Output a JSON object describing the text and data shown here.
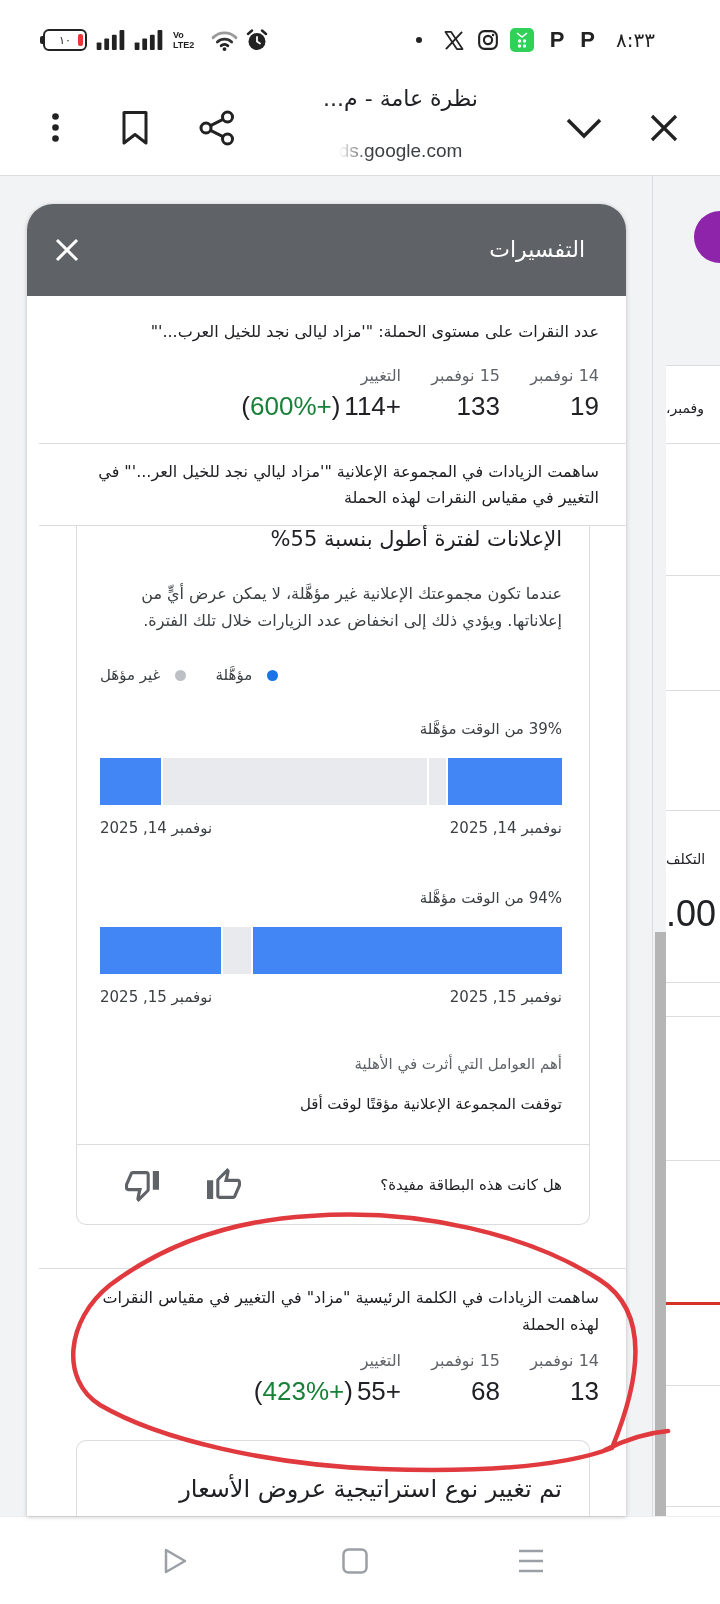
{
  "status_bar": {
    "time": "٨:٣٣",
    "notification_icons": [
      {
        "kind": "letter",
        "text": "P"
      },
      {
        "kind": "letter",
        "text": "P"
      },
      {
        "kind": "store"
      },
      {
        "kind": "instagram"
      },
      {
        "kind": "x"
      },
      {
        "kind": "dot"
      }
    ],
    "network_label": "Vo LTE2",
    "battery_label": "١٠"
  },
  "browser_bar": {
    "title": "نظرة عامة - م...",
    "url": "ds.google.com"
  },
  "background_page": {
    "date_fragment": "وفمبر،",
    "cost_label": "التكلف",
    "cost_value": ".00"
  },
  "panel": {
    "title": "التفسيرات",
    "summary": {
      "text": "عدد النقرات على مستوى الحملة: \"'مزاد ليالى نجد للخيل العرب...'\"",
      "columns": [
        {
          "kind": "count",
          "label": "14 نوفمبر",
          "value": "19"
        },
        {
          "kind": "count",
          "label": "15 نوفمبر",
          "value": "133"
        },
        {
          "kind": "change",
          "label": "التغيير",
          "value": "+114",
          "change_percent": "(+600%)"
        }
      ]
    },
    "contribution_note": "ساهمت الزيادات في المجموعة الإعلانية \"'مزاد ليالي نجد للخيل العر...'\" في التغيير في مقياس النقرات لهذه الحملة",
    "insight_card": {
      "heading": "الإعلانات لفترة أطول بنسبة 55%",
      "description": "عندما تكون مجموعتك الإعلانية غير مؤهَّلة، لا يمكن عرض أيٍّ من إعلاناتها. ويؤدي ذلك إلى انخفاض عدد الزيارات خلال تلك الفترة.",
      "legend": [
        {
          "label": "مؤهَّلة",
          "color": "#1a73e8"
        },
        {
          "label": "غير مؤهَل",
          "color": "#bdc1c6"
        }
      ],
      "timelines": [
        {
          "caption": "39% من الوقت مؤهَّلة",
          "segments": [
            {
              "kind": "eligible"
            },
            {
              "kind": "ineligible"
            },
            {
              "kind": "ineligible"
            },
            {
              "kind": "eligible"
            }
          ],
          "start_date": "نوفمبر 14, 2025",
          "end_date": "نوفمبر 14, 2025"
        },
        {
          "caption": "94% من الوقت مؤهَّلة",
          "segments": [
            {
              "kind": "eligible"
            },
            {
              "kind": "ineligible"
            },
            {
              "kind": "eligible"
            }
          ],
          "start_date": "نوفمبر 15, 2025",
          "end_date": "نوفمبر 15, 2025"
        }
      ],
      "factors_title": "أهم العوامل التي أثرت في الأهلية",
      "factor": "توقفت المجموعة الإعلانية مؤقتًا لوقت أقل",
      "feedback_question": "هل كانت هذه البطاقة مفيدة؟"
    },
    "keyword_contribution": {
      "text": "ساهمت الزيادات في الكلمة الرئيسية \"مزاد\" في التغيير في مقياس النقرات لهذه الحملة",
      "columns": [
        {
          "kind": "count",
          "label": "14 نوفمبر",
          "value": "13"
        },
        {
          "kind": "count",
          "label": "15 نوفمبر",
          "value": "68"
        },
        {
          "kind": "change",
          "label": "التغيير",
          "value": "+55",
          "change_percent": "(+423%)"
        }
      ]
    },
    "next_card": {
      "heading": "تم تغيير نوع استراتيجية عروض الأسعار"
    }
  }
}
